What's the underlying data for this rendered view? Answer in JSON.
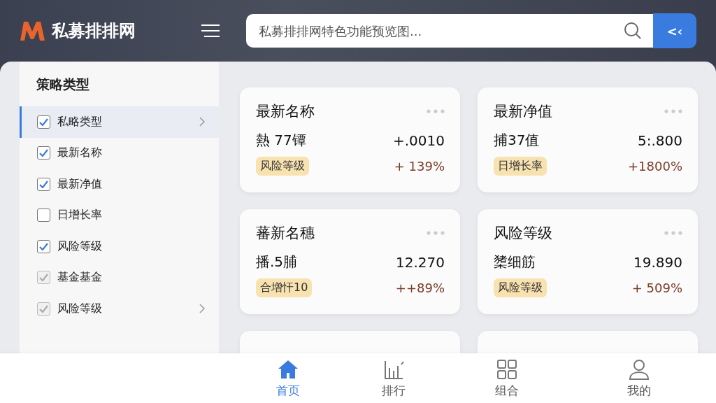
{
  "header": {
    "logo_text": "私募排排网",
    "search": {
      "placeholder": "私募排排网特色功能预览图..."
    },
    "action_button": "<‹"
  },
  "sidebar": {
    "title": "策略类型",
    "items": [
      {
        "label": "私略类型",
        "checked": true,
        "disabled": false,
        "selected": true,
        "has_submenu": true
      },
      {
        "label": "最新名称",
        "checked": true,
        "disabled": false,
        "selected": false,
        "has_submenu": false
      },
      {
        "label": "最新净值",
        "checked": true,
        "disabled": false,
        "selected": false,
        "has_submenu": false
      },
      {
        "label": "日增长率",
        "checked": false,
        "disabled": false,
        "selected": false,
        "has_submenu": false
      },
      {
        "label": "风险等级",
        "checked": true,
        "disabled": false,
        "selected": false,
        "has_submenu": false
      },
      {
        "label": "基金基金",
        "checked": true,
        "disabled": true,
        "selected": false,
        "has_submenu": false
      },
      {
        "label": "风险等级",
        "checked": true,
        "disabled": true,
        "selected": false,
        "has_submenu": true
      }
    ]
  },
  "cards": [
    {
      "title": "最新名称",
      "name": "熱 77镡",
      "value": "+.0010",
      "tag": "风险等级",
      "change": "+ 139%"
    },
    {
      "title": "最新净值",
      "name": "捕37值",
      "value": "5:.800",
      "tag": "日增长率",
      "change": "+1800%"
    },
    {
      "title": "蕃新名穗",
      "name": "播.5脯",
      "value": "12.270",
      "tag": "合增忓10",
      "change": "++89%"
    },
    {
      "title": "风险等级",
      "name": "橥细筋",
      "value": "19.890",
      "tag": "风险等级",
      "change": "+ 509%"
    },
    {
      "kind": "partial"
    },
    {
      "kind": "partial"
    }
  ],
  "tab_bar": [
    {
      "label": "首页",
      "selected": true
    },
    {
      "label": "排行",
      "selected": false
    },
    {
      "label": "组合",
      "selected": false
    },
    {
      "label": "我的",
      "selected": false
    }
  ]
}
